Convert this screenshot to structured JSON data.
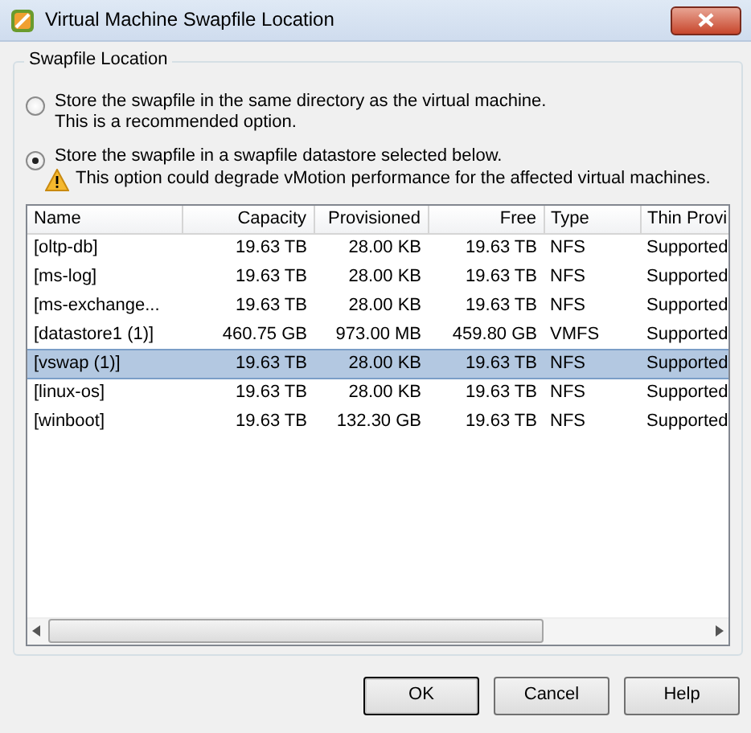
{
  "window": {
    "title": "Virtual Machine Swapfile Location"
  },
  "group": {
    "title": "Swapfile Location",
    "options": [
      {
        "label": "Store the swapfile in the same directory as the virtual machine.",
        "note": "This is a recommended option.",
        "kind": "info",
        "selected": false
      },
      {
        "label": "Store the swapfile in a swapfile datastore selected below.",
        "note": "This option could degrade vMotion performance for the affected virtual machines.",
        "kind": "warning",
        "selected": true
      }
    ]
  },
  "table": {
    "columns": [
      {
        "label": "Name",
        "kind": "text"
      },
      {
        "label": "Capacity",
        "kind": "size"
      },
      {
        "label": "Provisioned",
        "kind": "size"
      },
      {
        "label": "Free",
        "kind": "size"
      },
      {
        "label": "Type",
        "kind": "text"
      },
      {
        "label": "Thin Provi",
        "kind": "text"
      }
    ],
    "rows": [
      {
        "cells": [
          "[oltp-db]",
          "19.63 TB",
          "28.00 KB",
          "19.63 TB",
          "NFS",
          "Supported"
        ],
        "selected": false
      },
      {
        "cells": [
          "[ms-log]",
          "19.63 TB",
          "28.00 KB",
          "19.63 TB",
          "NFS",
          "Supported"
        ],
        "selected": false
      },
      {
        "cells": [
          "[ms-exchange...",
          "19.63 TB",
          "28.00 KB",
          "19.63 TB",
          "NFS",
          "Supported"
        ],
        "selected": false
      },
      {
        "cells": [
          "[datastore1 (1)]",
          "460.75 GB",
          "973.00 MB",
          "459.80 GB",
          "VMFS",
          "Supported"
        ],
        "selected": false
      },
      {
        "cells": [
          "[vswap (1)]",
          "19.63 TB",
          "28.00 KB",
          "19.63 TB",
          "NFS",
          "Supported"
        ],
        "selected": true
      },
      {
        "cells": [
          "[linux-os]",
          "19.63 TB",
          "28.00 KB",
          "19.63 TB",
          "NFS",
          "Supported"
        ],
        "selected": false
      },
      {
        "cells": [
          "[winboot]",
          "19.63 TB",
          "132.30 GB",
          "19.63 TB",
          "NFS",
          "Supported"
        ],
        "selected": false
      }
    ]
  },
  "buttons": [
    {
      "label": "OK",
      "default": true
    },
    {
      "label": "Cancel",
      "default": false
    },
    {
      "label": "Help",
      "default": false
    }
  ]
}
